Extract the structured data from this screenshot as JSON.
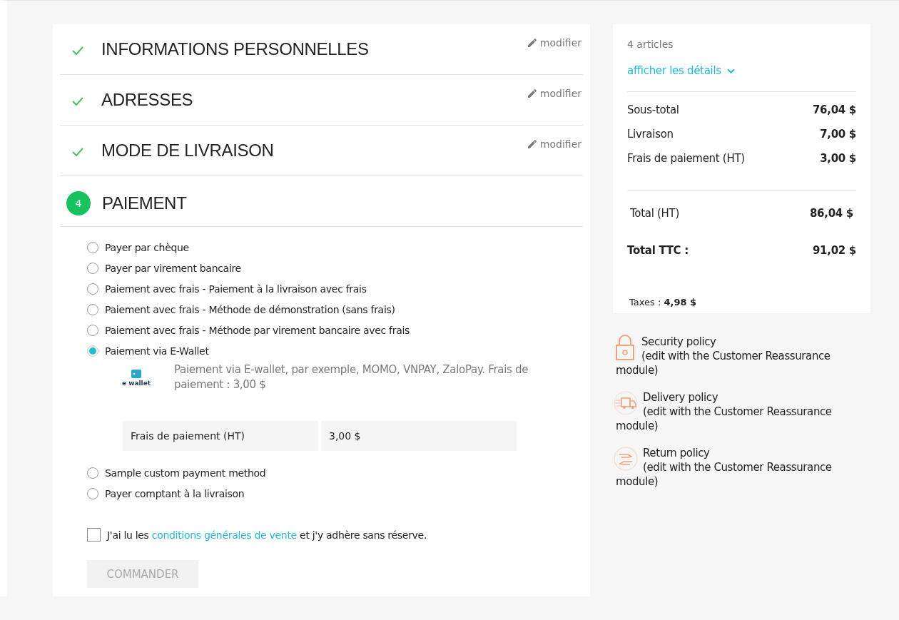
{
  "steps": [
    {
      "title": "INFORMATIONS PERSONNELLES",
      "kind": "done",
      "edit_label": "modifier"
    },
    {
      "title": "ADRESSES",
      "kind": "done",
      "edit_label": "modifier"
    },
    {
      "title": "MODE DE LIVRAISON",
      "kind": "done",
      "edit_label": "modifier"
    },
    {
      "title": "PAIEMENT",
      "kind": "current",
      "number": "4"
    }
  ],
  "payment_options": [
    {
      "label": "Payer par chèque",
      "selected": false
    },
    {
      "label": "Payer par virement bancaire",
      "selected": false
    },
    {
      "label": "Paiement avec frais - Paiement à la livraison avec frais",
      "selected": false
    },
    {
      "label": "Paiement avec frais - Méthode de démonstration (sans frais)",
      "selected": false
    },
    {
      "label": "Paiement avec frais - Méthode par virement bancaire avec frais",
      "selected": false
    },
    {
      "label": "Paiement via E-Wallet",
      "selected": true,
      "details": {
        "logo_text": "e wallet",
        "description": "Paiement via E-wallet, par exemple, MOMO, VNPAY, ZaloPay. Frais de paiement : 3,00 $",
        "fee_label": "Frais de paiement (HT)",
        "fee_value": "3,00 $"
      }
    },
    {
      "label": "Sample custom payment method",
      "selected": false
    },
    {
      "label": "Payer comptant à la livraison",
      "selected": false
    }
  ],
  "terms": {
    "checked": false,
    "before": "J'ai lu les",
    "link": "conditions générales de vente",
    "after": "et j'y adhère sans réserve."
  },
  "order_button": {
    "label": "COMMANDER",
    "disabled": true
  },
  "summary": {
    "count": "4 articles",
    "details_link": "afficher les détails",
    "lines": [
      {
        "label": "Sous-total",
        "value": "76,04 $"
      },
      {
        "label": "Livraison",
        "value": "7,00 $"
      },
      {
        "label": "Frais de paiement (HT)",
        "value": "3,00 $"
      }
    ],
    "total_ht": {
      "label": "Total (HT)",
      "value": "86,04 $"
    },
    "total_ttc": {
      "label": "Total TTC :",
      "value": "91,02 $"
    },
    "taxes": {
      "label": "Taxes :",
      "value": "4,98 $"
    }
  },
  "reassurance": [
    {
      "kind": "lock",
      "title": "Security policy",
      "text": "(edit with the Customer Reassurance module)"
    },
    {
      "kind": "truck",
      "title": "Delivery policy",
      "text": "(edit with the Customer Reassurance module)"
    },
    {
      "kind": "hands",
      "title": "Return policy",
      "text": "(edit with the Customer Reassurance module)"
    }
  ]
}
